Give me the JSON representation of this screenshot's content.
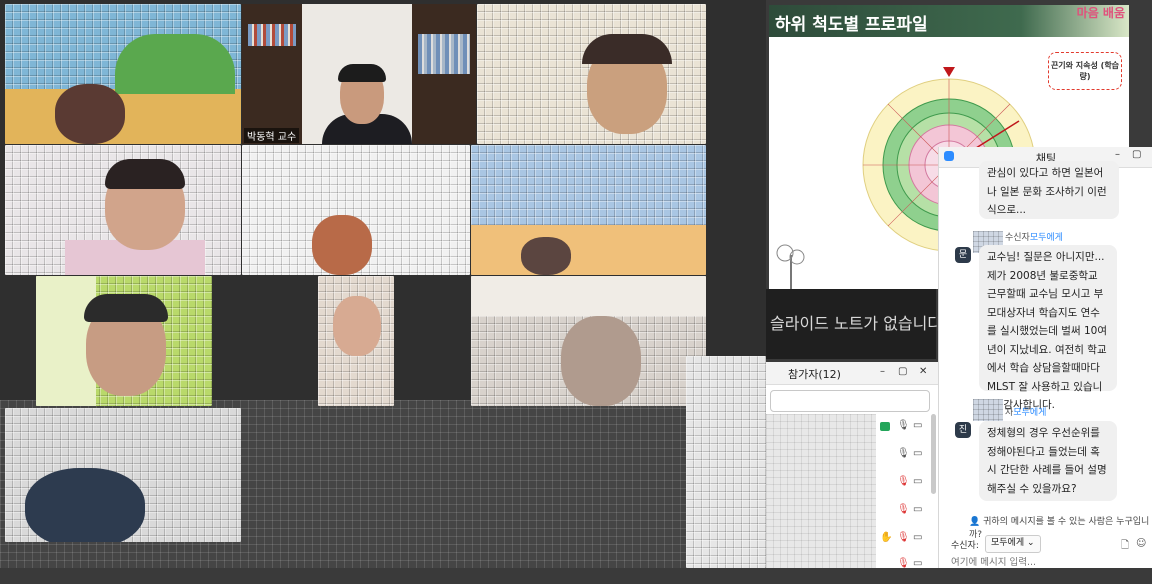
{
  "gallery": {
    "presenter_name": "박동혁 교수"
  },
  "slide": {
    "title": "하위 척도별 프로파일",
    "logo_text": "마음 배움",
    "callout": "끈기와 지속성 (학습량)",
    "notes_placeholder": "슬라이드 노트가 없습니다"
  },
  "participants": {
    "title": "참가자(12)",
    "minimize": "–",
    "popout": "▢",
    "close": "✕"
  },
  "chat": {
    "title": "채팅",
    "messages": [
      {
        "partial_text": "관심이 있다고 하면 일본어나 일본 문화 조사하기 이런식으로...",
        "to_prefix": "수신자",
        "to_target": "모두에게"
      },
      {
        "avatar": "문",
        "text": "교수님! 질문은 아니지만... 제가 2008년 불로중학교 근무할때 교수님 모시고 부모대상자녀 학습지도 연수를 실시했었는데 벌써 10여년이 지났네요. 여전히 학교에서 학습 상담을할때마다 MLST 잘 사용하고 있습니다. 감사합니다.",
        "to_prefix": "자",
        "to_target": "모두에게"
      },
      {
        "avatar": "진",
        "text": "정체형의 경우 우선순위를 정해야된다고 들었는데 혹시 간단한 사례를 들어 설명해주실 수 있을까요?"
      }
    ],
    "who_can_see": "귀하의 메시지를 볼 수 있는 사람은 누구입니까?",
    "recipient_label": "수신자:",
    "recipient_value": "모두에게",
    "input_placeholder": "여기에 메시지 입력..."
  },
  "colors": {
    "zoom_blue": "#2d8cff",
    "slide_green": "#3f6a4e",
    "callout_red": "#e23b2e"
  }
}
